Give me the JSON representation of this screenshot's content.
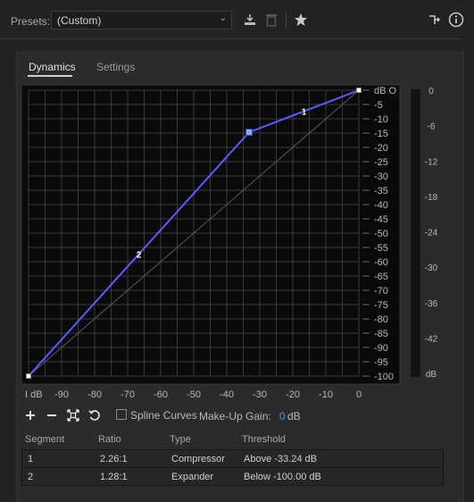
{
  "header": {
    "presets_label": "Presets:",
    "preset_value": "(Custom)",
    "icons": [
      "download-icon",
      "trash-icon",
      "star-icon",
      "routing-icon",
      "info-icon"
    ]
  },
  "tabs": [
    {
      "label": "Dynamics",
      "active": true
    },
    {
      "label": "Settings",
      "active": false
    }
  ],
  "graph": {
    "x_ticks": [
      "I dB",
      "-90",
      "-80",
      "-70",
      "-60",
      "-50",
      "-40",
      "-30",
      "-20",
      "-10",
      "0"
    ],
    "y_ticks": [
      "dB O",
      "-5",
      "-10",
      "-15",
      "-20",
      "-25",
      "-30",
      "-35",
      "-40",
      "-45",
      "-50",
      "-55",
      "-60",
      "-65",
      "-70",
      "-75",
      "-80",
      "-85",
      "-90",
      "-95",
      "-100"
    ],
    "meter_ticks": [
      "0",
      "-6",
      "-12",
      "-18",
      "-24",
      "-30",
      "-36",
      "-42",
      "dB"
    ],
    "curve_color": "#5a5cff",
    "points": [
      {
        "in": -100,
        "out": -100
      },
      {
        "in": -33.24,
        "out": -14.7
      },
      {
        "in": 0,
        "out": 0
      }
    ],
    "segment_labels": [
      "1",
      "2"
    ]
  },
  "tools": {
    "spline_label": "Spline Curves",
    "makeup_label": "Make-Up Gain:",
    "makeup_value": "0",
    "makeup_unit": "dB"
  },
  "table": {
    "headers": [
      "Segment",
      "Ratio",
      "Type",
      "Threshold"
    ],
    "rows": [
      {
        "segment": "1",
        "ratio": "2.26:1",
        "type": "Compressor",
        "threshold": "Above -33.24 dB"
      },
      {
        "segment": "2",
        "ratio": "1.28:1",
        "type": "Expander",
        "threshold": "Below -100.00 dB"
      }
    ]
  }
}
